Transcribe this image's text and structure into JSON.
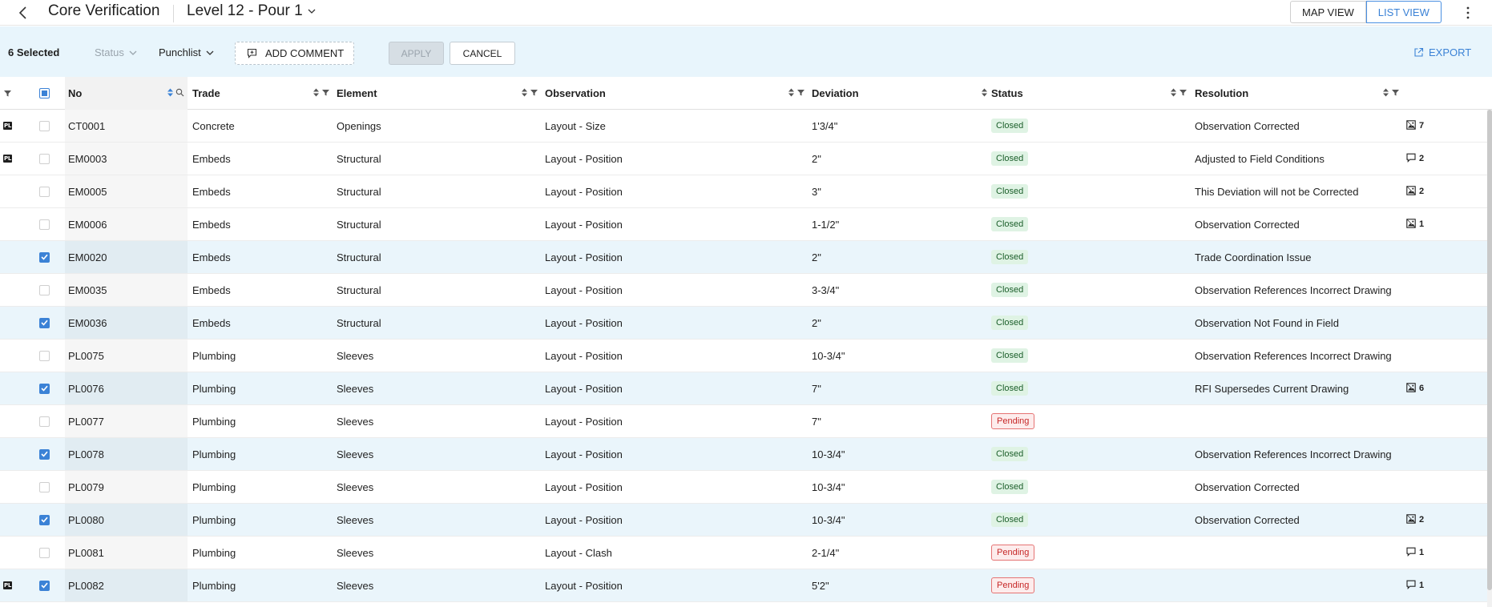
{
  "header": {
    "title": "Core Verification",
    "pour": "Level 12 - Pour 1",
    "views": [
      "MAP VIEW",
      "LIST VIEW"
    ]
  },
  "actions": {
    "selected": "6 Selected",
    "status": "Status",
    "punchlist": "Punchlist",
    "add_comment": "ADD COMMENT",
    "apply": "APPLY",
    "cancel": "CANCEL",
    "export": "EXPORT"
  },
  "columns": [
    "No",
    "Trade",
    "Element",
    "Observation",
    "Deviation",
    "Status",
    "Resolution"
  ],
  "colors": {
    "accent": "#3b82d6",
    "selected_row": "#eaf5fb",
    "closed_bg": "#dff3e4",
    "pending_text": "#c62828"
  },
  "rows": [
    {
      "pl": "PL",
      "checked": false,
      "no": "CT0001",
      "trade": "Concrete",
      "element": "Openings",
      "observation": "Layout - Size",
      "deviation": "1'3/4\"",
      "status": "Closed",
      "resolution": "Observation Corrected",
      "attach_icon": "image-icon",
      "attach_count": "7"
    },
    {
      "pl": "PL",
      "checked": false,
      "no": "EM0003",
      "trade": "Embeds",
      "element": "Structural",
      "observation": "Layout - Position",
      "deviation": "2\"",
      "status": "Closed",
      "resolution": "Adjusted to Field Conditions",
      "attach_icon": "comment-icon",
      "attach_count": "2"
    },
    {
      "pl": "",
      "checked": false,
      "no": "EM0005",
      "trade": "Embeds",
      "element": "Structural",
      "observation": "Layout - Position",
      "deviation": "3\"",
      "status": "Closed",
      "resolution": "This Deviation will not be Corrected",
      "attach_icon": "image-icon",
      "attach_count": "2"
    },
    {
      "pl": "",
      "checked": false,
      "no": "EM0006",
      "trade": "Embeds",
      "element": "Structural",
      "observation": "Layout - Position",
      "deviation": "1-1/2\"",
      "status": "Closed",
      "resolution": "Observation Corrected",
      "attach_icon": "image-icon",
      "attach_count": "1"
    },
    {
      "pl": "",
      "checked": true,
      "no": "EM0020",
      "trade": "Embeds",
      "element": "Structural",
      "observation": "Layout - Position",
      "deviation": "2\"",
      "status": "Closed",
      "resolution": "Trade Coordination Issue",
      "attach_icon": "",
      "attach_count": ""
    },
    {
      "pl": "",
      "checked": false,
      "no": "EM0035",
      "trade": "Embeds",
      "element": "Structural",
      "observation": "Layout - Position",
      "deviation": "3-3/4\"",
      "status": "Closed",
      "resolution": "Observation References Incorrect Drawing",
      "attach_icon": "",
      "attach_count": ""
    },
    {
      "pl": "",
      "checked": true,
      "no": "EM0036",
      "trade": "Embeds",
      "element": "Structural",
      "observation": "Layout - Position",
      "deviation": "2\"",
      "status": "Closed",
      "resolution": "Observation Not Found in Field",
      "attach_icon": "",
      "attach_count": ""
    },
    {
      "pl": "",
      "checked": false,
      "no": "PL0075",
      "trade": "Plumbing",
      "element": "Sleeves",
      "observation": "Layout - Position",
      "deviation": "10-3/4\"",
      "status": "Closed",
      "resolution": "Observation References Incorrect Drawing",
      "attach_icon": "",
      "attach_count": ""
    },
    {
      "pl": "",
      "checked": true,
      "no": "PL0076",
      "trade": "Plumbing",
      "element": "Sleeves",
      "observation": "Layout - Position",
      "deviation": "7\"",
      "status": "Closed",
      "resolution": "RFI Supersedes Current Drawing",
      "attach_icon": "image-icon",
      "attach_count": "6"
    },
    {
      "pl": "",
      "checked": false,
      "no": "PL0077",
      "trade": "Plumbing",
      "element": "Sleeves",
      "observation": "Layout - Position",
      "deviation": "7\"",
      "status": "Pending",
      "resolution": "",
      "attach_icon": "",
      "attach_count": ""
    },
    {
      "pl": "",
      "checked": true,
      "no": "PL0078",
      "trade": "Plumbing",
      "element": "Sleeves",
      "observation": "Layout - Position",
      "deviation": "10-3/4\"",
      "status": "Closed",
      "resolution": "Observation References Incorrect Drawing",
      "attach_icon": "",
      "attach_count": ""
    },
    {
      "pl": "",
      "checked": false,
      "no": "PL0079",
      "trade": "Plumbing",
      "element": "Sleeves",
      "observation": "Layout - Position",
      "deviation": "10-3/4\"",
      "status": "Closed",
      "resolution": "Observation Corrected",
      "attach_icon": "",
      "attach_count": ""
    },
    {
      "pl": "",
      "checked": true,
      "no": "PL0080",
      "trade": "Plumbing",
      "element": "Sleeves",
      "observation": "Layout - Position",
      "deviation": "10-3/4\"",
      "status": "Closed",
      "resolution": "Observation Corrected",
      "attach_icon": "image-icon",
      "attach_count": "2"
    },
    {
      "pl": "",
      "checked": false,
      "no": "PL0081",
      "trade": "Plumbing",
      "element": "Sleeves",
      "observation": "Layout - Clash",
      "deviation": "2-1/4\"",
      "status": "Pending",
      "resolution": "",
      "attach_icon": "comment-icon",
      "attach_count": "1"
    },
    {
      "pl": "PL",
      "checked": true,
      "no": "PL0082",
      "trade": "Plumbing",
      "element": "Sleeves",
      "observation": "Layout - Position",
      "deviation": "5'2\"",
      "status": "Pending",
      "resolution": "",
      "attach_icon": "comment-icon",
      "attach_count": "1"
    }
  ]
}
